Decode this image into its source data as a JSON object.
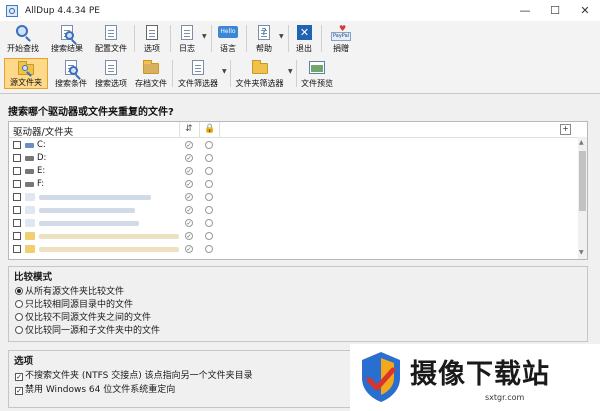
{
  "window": {
    "title": "AllDup 4.4.34 PE",
    "minimize": "—",
    "maximize": "☐",
    "close": "✕"
  },
  "toolbar1": [
    {
      "label": "开始查找",
      "icon": "search-start-icon"
    },
    {
      "label": "搜索结果",
      "icon": "search-results-icon"
    },
    {
      "label": "配置文件",
      "icon": "profile-icon"
    },
    {
      "label": "选项",
      "icon": "options-icon"
    },
    {
      "label": "日志",
      "icon": "log-icon"
    },
    {
      "label": "语言",
      "icon": "language-icon",
      "badge": "Hello"
    },
    {
      "label": "帮助",
      "icon": "help-icon"
    },
    {
      "label": "退出",
      "icon": "exit-icon"
    },
    {
      "label": "捐赠",
      "icon": "donate-icon",
      "badge": "PayPal"
    }
  ],
  "toolbar2": [
    {
      "label": "源文件夹",
      "icon": "source-folder-icon",
      "active": true
    },
    {
      "label": "搜索条件",
      "icon": "search-criteria-icon"
    },
    {
      "label": "搜索选项",
      "icon": "search-options-icon"
    },
    {
      "label": "存档文件",
      "icon": "archive-icon"
    },
    {
      "label": "文件筛选器",
      "icon": "file-filter-icon"
    },
    {
      "label": "文件夹筛选器",
      "icon": "folder-filter-icon"
    },
    {
      "label": "文件预览",
      "icon": "file-preview-icon"
    }
  ],
  "main": {
    "heading": "搜索哪个驱动器或文件夹重复的文件?",
    "column_header": "驱动器/文件夹",
    "plus": "+",
    "drives": [
      {
        "label": "C:",
        "type": "system"
      },
      {
        "label": "D:",
        "type": "drive"
      },
      {
        "label": "E:",
        "type": "drive"
      },
      {
        "label": "F:",
        "type": "drive"
      }
    ],
    "folders_count_blurred": 5
  },
  "compare_mode": {
    "title": "比较模式",
    "options": [
      {
        "label": "从所有源文件夹比较文件",
        "selected": true
      },
      {
        "label": "只比较相同源目录中的文件",
        "selected": false
      },
      {
        "label": "仅比较不同源文件夹之间的文件",
        "selected": false
      },
      {
        "label": "仅比较同一源和子文件夹中的文件",
        "selected": false
      }
    ]
  },
  "options_group": {
    "title": "选项",
    "items": [
      {
        "label": "不搜索文件夹 (NTFS 交接点) 该点指向另一个文件夹目录",
        "checked": true
      },
      {
        "label": "禁用 Windows 64 位文件系统重定向",
        "checked": true
      }
    ]
  },
  "watermark": {
    "text": "摄像下载站",
    "url": "sxtgr.com"
  }
}
